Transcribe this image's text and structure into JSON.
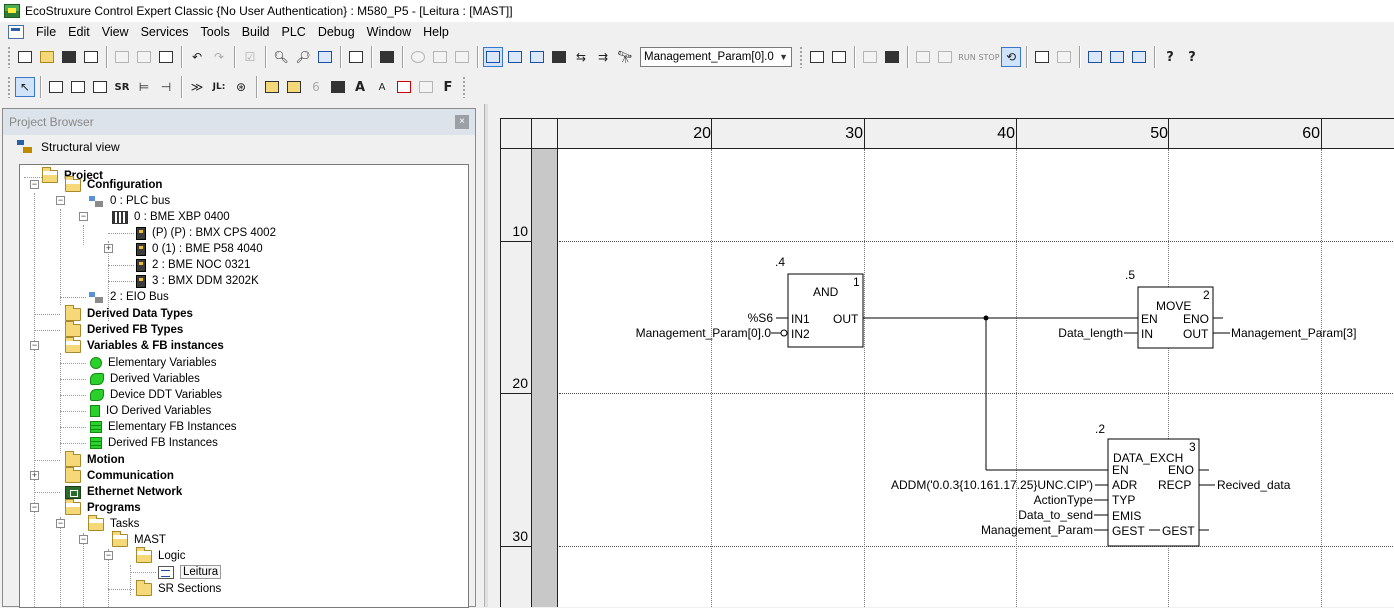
{
  "window": {
    "title": "EcoStruxure Control Expert Classic {No User Authentication} : M580_P5 - [Leitura : [MAST]]"
  },
  "menu": [
    "File",
    "Edit",
    "View",
    "Services",
    "Tools",
    "Build",
    "PLC",
    "Debug",
    "Window",
    "Help"
  ],
  "toolbar": {
    "variable_combo": "Management_Param[0].0",
    "letter_f": "F"
  },
  "project_browser": {
    "title": "Project Browser",
    "view_label": "Structural view",
    "tree": {
      "project": "Project",
      "configuration": "Configuration",
      "plc_bus": "0 : PLC bus",
      "rack": "0 : BME XBP 0400",
      "cps": "(P) (P) : BMX CPS 4002",
      "cpu": "0 (1) : BME P58 4040",
      "noc": "2 : BME NOC 0321",
      "ddm": "3 : BMX DDM 3202K",
      "eio_bus": "2 : EIO Bus",
      "derived_data_types": "Derived Data Types",
      "derived_fb_types": "Derived FB Types",
      "variables": "Variables & FB instances",
      "elementary_variables": "Elementary Variables",
      "derived_variables": "Derived Variables",
      "device_ddt_variables": "Device DDT Variables",
      "io_derived_variables": "IO Derived Variables",
      "elementary_fb_instances": "Elementary FB Instances",
      "derived_fb_instances": "Derived FB Instances",
      "motion": "Motion",
      "communication": "Communication",
      "ethernet_network": "Ethernet Network",
      "programs": "Programs",
      "tasks": "Tasks",
      "mast": "MAST",
      "logic": "Logic",
      "leitura": "Leitura",
      "sr_sections": "SR Sections"
    }
  },
  "editor": {
    "columns": [
      "20",
      "30",
      "40",
      "50",
      "60"
    ],
    "rows": [
      "10",
      "20",
      "30"
    ],
    "blocks": {
      "and": {
        "name": "AND",
        "exec_order": ".4",
        "instance_no": "1",
        "in1": "IN1",
        "in2": "IN2",
        "out": "OUT",
        "in1_var": "%S6",
        "in2_var": "Management_Param[0].0"
      },
      "move": {
        "name": "MOVE",
        "exec_order": ".5",
        "instance_no": "2",
        "en": "EN",
        "eno": "ENO",
        "in": "IN",
        "out": "OUT",
        "in_var": "Data_length",
        "out_var": "Management_Param[3]"
      },
      "data_exch": {
        "name": "DATA_EXCH",
        "exec_order": ".2",
        "instance_no": "3",
        "en": "EN",
        "eno": "ENO",
        "adr": "ADR",
        "recp": "RECP",
        "typ": "TYP",
        "emis": "EMIS",
        "gest_in": "GEST",
        "gest_out": "GEST",
        "adr_var": "ADDM('0.0.3{10.161.17.25}UNC.CIP')",
        "typ_var": "ActionType",
        "emis_var": "Data_to_send",
        "gest_var": "Management_Param",
        "recp_var": "Recived_data"
      }
    }
  }
}
